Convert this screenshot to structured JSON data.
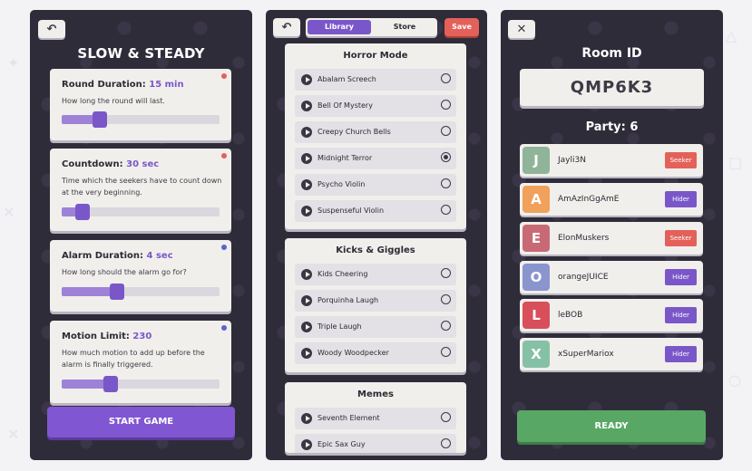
{
  "colors": {
    "accent_purple": "#7a57c9",
    "save_red": "#e36159",
    "ready_green": "#59a765",
    "seeker_red": "#e36159",
    "hider_purple": "#7a57c9",
    "panel_bg": "#2f2c3a",
    "card_bg": "#f1efec"
  },
  "settings_screen": {
    "back_icon": "arrow-back-icon",
    "title": "SLOW & STEADY",
    "cards": [
      {
        "label": "Round Duration:",
        "value": "15 min",
        "desc": "How long the round will last.",
        "dot_color": "#e36159",
        "slider_fraction": 0.24
      },
      {
        "label": "Countdown:",
        "value": "30 sec",
        "desc": "Time which the seekers have to count down at the very beginning.",
        "dot_color": "#e36159",
        "slider_fraction": 0.13
      },
      {
        "label": "Alarm Duration:",
        "value": "4 sec",
        "desc": "How long should the alarm go for?",
        "dot_color": "#5b63c9",
        "slider_fraction": 0.35
      },
      {
        "label": "Motion Limit:",
        "value": "230",
        "desc": "How much motion to add up before the alarm is finally triggered.",
        "dot_color": "#5b63c9",
        "slider_fraction": 0.31
      }
    ],
    "start_button": "START GAME"
  },
  "library_screen": {
    "back_icon": "arrow-back-icon",
    "tabs": {
      "library": "Library",
      "store": "Store"
    },
    "save_button": "Save",
    "groups": [
      {
        "title": "Horror Mode",
        "sounds": [
          {
            "name": "Abalam Screech",
            "selected": false
          },
          {
            "name": "Bell Of Mystery",
            "selected": false
          },
          {
            "name": "Creepy Church Bells",
            "selected": false
          },
          {
            "name": "Midnight Terror",
            "selected": true
          },
          {
            "name": "Psycho Violin",
            "selected": false
          },
          {
            "name": "Suspenseful Violin",
            "selected": false
          }
        ]
      },
      {
        "title": "Kicks & Giggles",
        "sounds": [
          {
            "name": "Kids Cheering",
            "selected": false
          },
          {
            "name": "Porquinha Laugh",
            "selected": false
          },
          {
            "name": "Triple Laugh",
            "selected": false
          },
          {
            "name": "Woody Woodpecker",
            "selected": false
          }
        ]
      },
      {
        "title": "Memes",
        "sounds": [
          {
            "name": "Seventh Element",
            "selected": false
          },
          {
            "name": "Epic Sax Guy",
            "selected": false
          }
        ]
      }
    ]
  },
  "room_screen": {
    "close_icon": "close-icon",
    "room_label": "Room ID",
    "room_code": "QMP6K3",
    "party_label": "Party: 6",
    "players": [
      {
        "initial": "J",
        "name": "Jayli3N",
        "role": "Seeker",
        "avatar_color": "#8fb49a"
      },
      {
        "initial": "A",
        "name": "AmAzInGgAmE",
        "role": "Hider",
        "avatar_color": "#f0a15c"
      },
      {
        "initial": "E",
        "name": "ElonMuskers",
        "role": "Seeker",
        "avatar_color": "#c76a75"
      },
      {
        "initial": "O",
        "name": "orangeJUICE",
        "role": "Hider",
        "avatar_color": "#8a95cf"
      },
      {
        "initial": "L",
        "name": "leBOB",
        "role": "Hider",
        "avatar_color": "#d94e5b"
      },
      {
        "initial": "X",
        "name": "xSuperMariox",
        "role": "Hider",
        "avatar_color": "#86c1a5"
      }
    ],
    "ready_button": "READY"
  }
}
